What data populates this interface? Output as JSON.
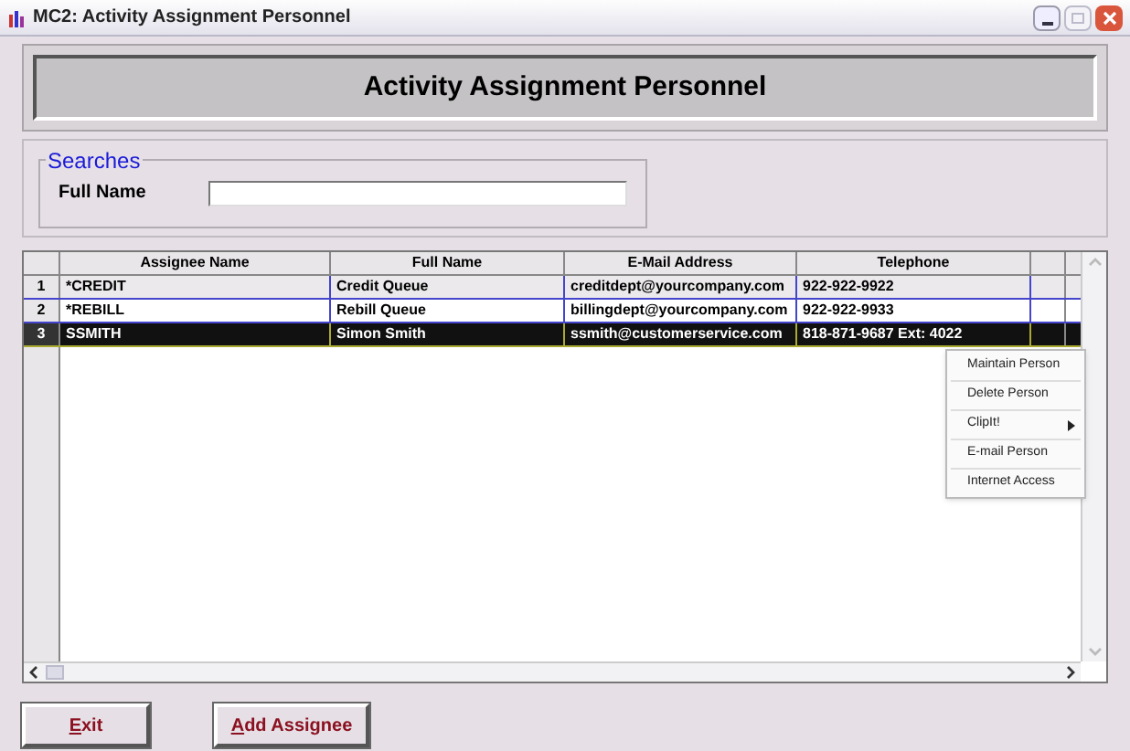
{
  "window": {
    "title": "MC2: Activity Assignment Personnel"
  },
  "header": {
    "title": "Activity Assignment Personnel"
  },
  "searches": {
    "legend": "Searches",
    "fields": [
      {
        "label": "Full Name"
      }
    ]
  },
  "table": {
    "columns": [
      "Assignee Name",
      "Full Name",
      "E-Mail Address",
      "Telephone"
    ],
    "rows": [
      {
        "number": "1",
        "cells": [
          "*CREDIT",
          "Credit Queue",
          "creditdept@yourcompany.com",
          "922-922-9922"
        ],
        "selected": false
      },
      {
        "number": "2",
        "cells": [
          "*REBILL",
          "Rebill Queue",
          "billingdept@yourcompany.com",
          "922-922-9933"
        ],
        "selected": false
      },
      {
        "number": "3",
        "cells": [
          "SSMITH",
          "Simon Smith",
          "ssmith@customerservice.com",
          "818-871-9687  Ext: 4022"
        ],
        "selected": true
      }
    ]
  },
  "context_menu": {
    "items": [
      {
        "label": "Maintain Person",
        "kind": "item"
      },
      {
        "label": "Delete Person",
        "kind": "item"
      },
      {
        "label": "ClipIt!",
        "kind": "submenu"
      },
      {
        "label": "E-mail Person",
        "kind": "item"
      },
      {
        "label": "Internet Access",
        "kind": "item"
      }
    ]
  },
  "buttons": [
    {
      "label": "Exit"
    },
    {
      "label": "Add Assignee"
    }
  ]
}
